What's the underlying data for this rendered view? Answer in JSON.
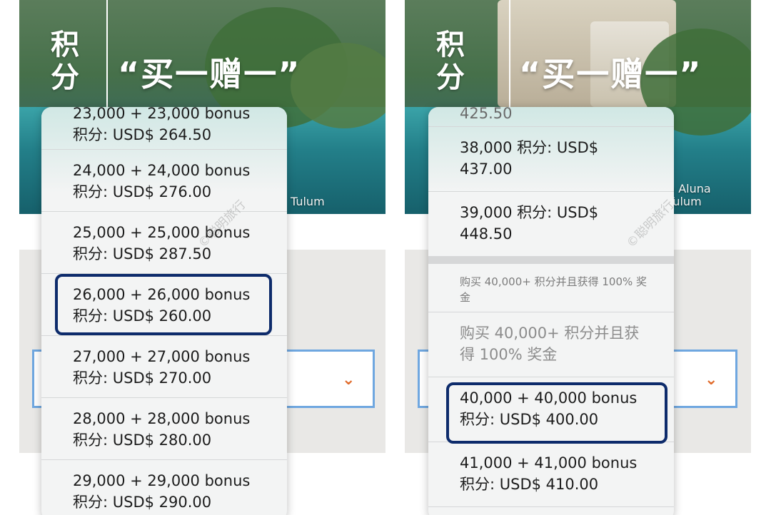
{
  "left": {
    "hero": {
      "points_label": "积分",
      "promo_title": "“买一赠一”",
      "caption": "Tulum"
    },
    "watermark": "©聪明旅行",
    "options": [
      {
        "label": "23,000 + 23,000 bonus 积分: USD$ 264.50"
      },
      {
        "label": "24,000 + 24,000 bonus 积分: USD$ 276.00"
      },
      {
        "label": "25,000 + 25,000 bonus 积分: USD$ 287.50"
      },
      {
        "label": "26,000 + 26,000 bonus 积分: USD$ 260.00",
        "highlighted": true
      },
      {
        "label": "27,000 + 27,000 bonus 积分: USD$ 270.00"
      },
      {
        "label": "28,000 + 28,000 bonus 积分: USD$ 280.00"
      },
      {
        "label": "29,000 + 29,000 bonus 积分: USD$ 290.00"
      }
    ]
  },
  "right": {
    "hero": {
      "points_label": "积分",
      "promo_title": "“买一赠一”",
      "caption": "n Aluna Tulum",
      "cut_off_text": "425.50"
    },
    "watermark": "©聪明旅行",
    "options": [
      {
        "label": "38,000 积分: USD$ 437.00"
      },
      {
        "label": "39,000 积分: USD$ 448.50"
      },
      {
        "label": "购买 40,000+ 积分并且获得 100% 奖金",
        "type": "header"
      },
      {
        "label": "购买 40,000+ 积分并且获得 100% 奖金",
        "type": "disabled"
      },
      {
        "label": "40,000 + 40,000 bonus 积分: USD$ 400.00",
        "highlighted": true
      },
      {
        "label": "41,000 + 41,000 bonus 积分: USD$ 410.00"
      }
    ]
  },
  "colors": {
    "highlight_border": "#0d2b6b",
    "select_border": "#6fa7e0",
    "chevron": "#e06a2a"
  },
  "icons": {
    "select_chevron": "chevron-down-icon"
  }
}
